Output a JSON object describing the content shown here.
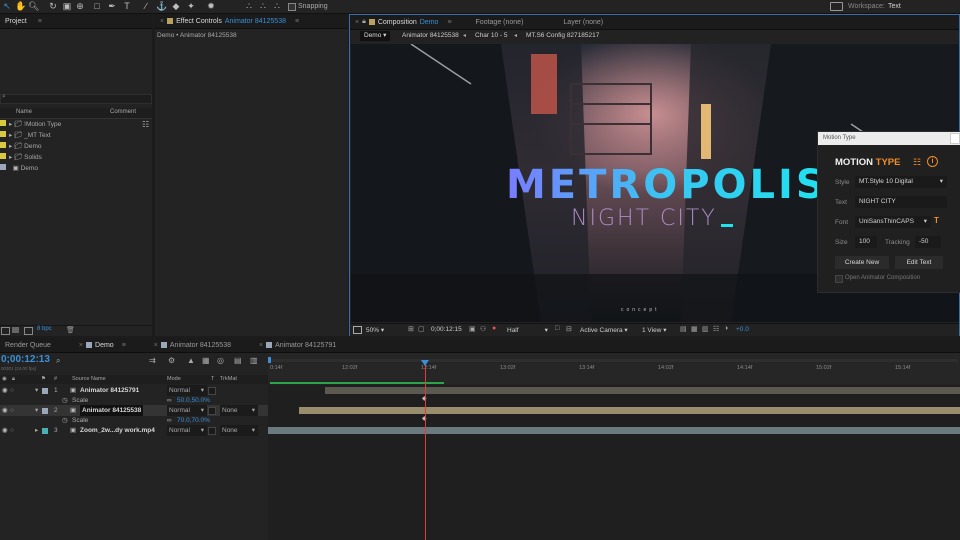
{
  "toolbar": {
    "snapping_label": "Snapping",
    "workspace_label": "Workspace:",
    "workspace_value": "Text"
  },
  "project": {
    "tab_label": "Project",
    "columns": {
      "name": "Name",
      "comment": "Comment"
    },
    "items": [
      {
        "label": "!Motion Type",
        "type": "folder",
        "color": "#d9c940"
      },
      {
        "label": "_MT Text",
        "type": "folder",
        "color": "#d9c940"
      },
      {
        "label": "Demo",
        "type": "folder",
        "color": "#d9c940"
      },
      {
        "label": "Solids",
        "type": "folder",
        "color": "#d9c940"
      },
      {
        "label": "Demo",
        "type": "composition",
        "color": "#9aa7b8"
      }
    ],
    "bpc_label": "8 bpc"
  },
  "effect_controls": {
    "tab_label": "Effect Controls",
    "tab_target": "Animator 84125538",
    "breadcrumb": "Demo • Animator 84125538"
  },
  "composition": {
    "tab_label": "Composition",
    "tab_target": "Demo",
    "footage_tab": "Footage (none)",
    "layer_tab": "Layer (none)",
    "nav": [
      {
        "label": "Demo"
      },
      {
        "label": "Animator 84125538"
      },
      {
        "label": "Char 10 - 5"
      },
      {
        "label": "MT.S6 Config 827185217"
      }
    ],
    "title_text": "METROPOLIS",
    "subtitle_text": "NIGHT CITY",
    "small_caption": "concept",
    "bottom_bar": {
      "zoom": "50%",
      "timecode": "0;00:12:15",
      "resolution": "Half",
      "camera": "Active Camera",
      "views": "1 View",
      "exposure": "+0.0"
    }
  },
  "motion_type": {
    "header": "Motion Type",
    "logo_main": "MOTION",
    "logo_accent": "TYPE",
    "style_label": "Style",
    "style_value": "MT.Style 10 Digital",
    "text_label": "Text",
    "text_value": "NIGHT CITY",
    "font_label": "Font",
    "font_value": "UniSansThinCAPS",
    "size_label": "Size",
    "size_value": "100",
    "tracking_label": "Tracking",
    "tracking_value": "-50",
    "create_button": "Create New",
    "edit_button": "Edit Text",
    "open_checkbox_label": "Open Animator Composition",
    "accent_color": "#f28c28"
  },
  "timeline": {
    "tabs": [
      {
        "label": "Render Queue",
        "color": ""
      },
      {
        "label": "Demo",
        "color": "#9aa7b8"
      },
      {
        "label": "Animator 84125538",
        "color": "#9aa7b8"
      },
      {
        "label": "Animator 84125791",
        "color": "#9aa7b8"
      }
    ],
    "timecode": "0;00:12:13",
    "timecode_sub": "00301 (24.00 fps)",
    "columns": {
      "source_name": "Source Name",
      "mode": "Mode",
      "t": "T",
      "trkmat": "TrkMat"
    },
    "layers": [
      {
        "num": "1",
        "name": "Animator 84125791",
        "mode": "Normal",
        "trkmat": "",
        "prop": "Scale",
        "prop_value": "50.0,50.0%"
      },
      {
        "num": "2",
        "name": "Animator 84125538",
        "mode": "Normal",
        "trkmat": "None",
        "prop": "Scale",
        "prop_value": "70.0,70.0%"
      },
      {
        "num": "3",
        "name": "Zoom_2w...dy work.mp4",
        "mode": "Normal",
        "trkmat": "None",
        "prop": "",
        "prop_value": ""
      }
    ],
    "ruler_labels": [
      "0:14f",
      "12:02f",
      "12:14f",
      "13:02f",
      "13:14f",
      "14:02f",
      "14:14f",
      "15:02f",
      "15:14f"
    ]
  }
}
